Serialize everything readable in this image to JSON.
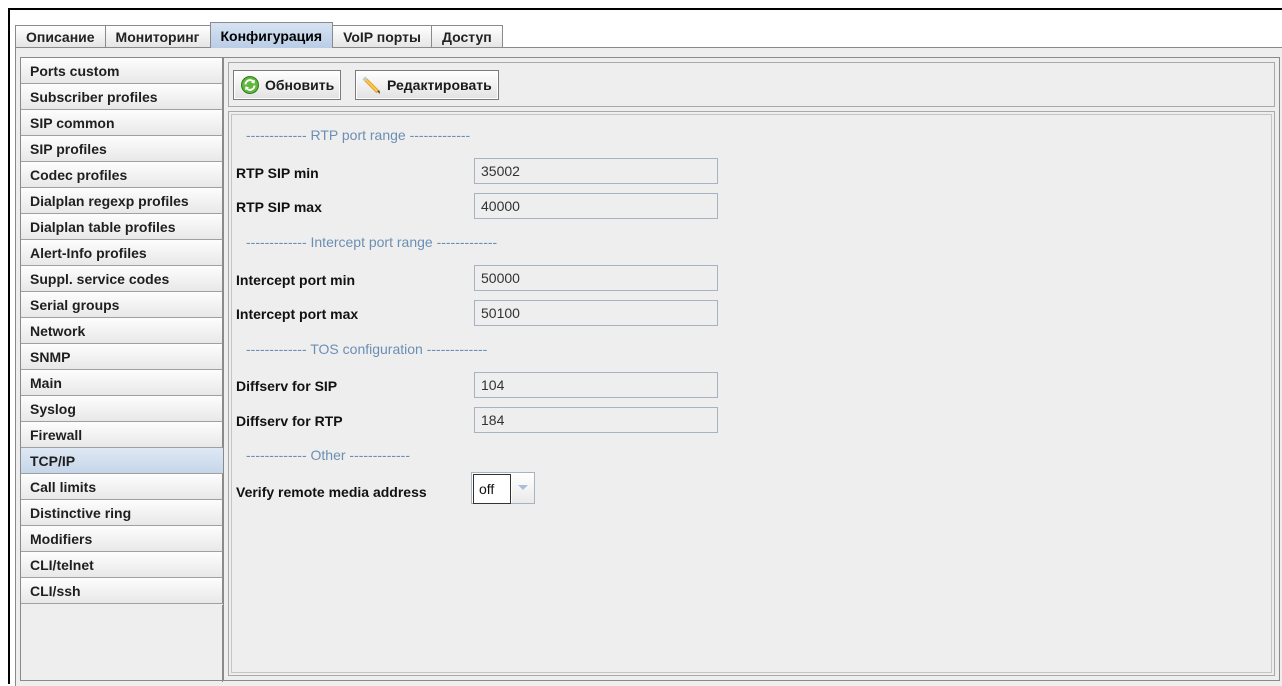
{
  "tabs": [
    {
      "label": "Описание",
      "active": false
    },
    {
      "label": "Мониторинг",
      "active": false
    },
    {
      "label": "Конфигурация",
      "active": true
    },
    {
      "label": "VoIP порты",
      "active": false
    },
    {
      "label": "Доступ",
      "active": false
    }
  ],
  "sidebar": {
    "items": [
      {
        "label": "Ports custom"
      },
      {
        "label": "Subscriber profiles"
      },
      {
        "label": "SIP common"
      },
      {
        "label": "SIP profiles"
      },
      {
        "label": "Codec profiles"
      },
      {
        "label": "Dialplan regexp profiles"
      },
      {
        "label": "Dialplan table profiles"
      },
      {
        "label": "Alert-Info profiles"
      },
      {
        "label": "Suppl. service codes"
      },
      {
        "label": "Serial groups"
      },
      {
        "label": "Network"
      },
      {
        "label": "SNMP"
      },
      {
        "label": "Main"
      },
      {
        "label": "Syslog"
      },
      {
        "label": "Firewall"
      },
      {
        "label": "TCP/IP",
        "selected": true
      },
      {
        "label": "Call limits"
      },
      {
        "label": "Distinctive ring"
      },
      {
        "label": "Modifiers"
      },
      {
        "label": "CLI/telnet"
      },
      {
        "label": "CLI/ssh"
      }
    ]
  },
  "toolbar": {
    "refresh_label": "Обновить",
    "edit_label": "Редактировать"
  },
  "form": {
    "section_rtp": "------------- RTP port range -------------",
    "rtp_min_label": "RTP SIP min",
    "rtp_min_value": "35002",
    "rtp_max_label": "RTP SIP max",
    "rtp_max_value": "40000",
    "section_intercept": "------------- Intercept port range -------------",
    "intercept_min_label": "Intercept port min",
    "intercept_min_value": "50000",
    "intercept_max_label": "Intercept port max",
    "intercept_max_value": "50100",
    "section_tos": "------------- TOS configuration -------------",
    "diffserv_sip_label": "Diffserv for SIP",
    "diffserv_sip_value": "104",
    "diffserv_rtp_label": "Diffserv for RTP",
    "diffserv_rtp_value": "184",
    "section_other": "------------- Other -------------",
    "verify_label": "Verify remote media address",
    "verify_value": "off"
  },
  "colors": {
    "section_text": "#6b8fb3",
    "active_tab": "#c6d6ea",
    "background": "#eeeeee"
  },
  "icons": {
    "refresh": "refresh-icon",
    "edit": "pencil-icon",
    "dropdown": "chevron-down-icon"
  }
}
